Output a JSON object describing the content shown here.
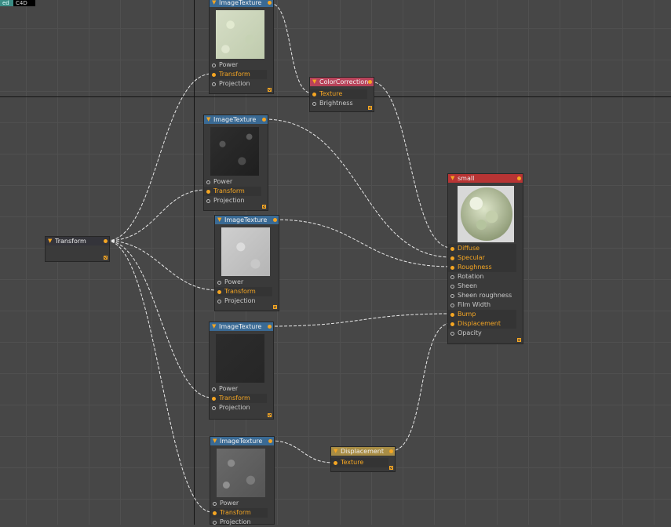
{
  "top_tags": {
    "left": "ed",
    "right": "C4D"
  },
  "colors": {
    "wire": "#e8e8e8",
    "port_accent": "#f5a623",
    "image_texture_header": "#3a6a94",
    "color_correction_header": "#b8435a",
    "material_header": "#b83434",
    "displacement_header": "#a88d45"
  },
  "nodes": {
    "transform": {
      "title": "Transform"
    },
    "tex1": {
      "title": "ImageTexture",
      "thumb": "light-green-marble-swatch",
      "ports": [
        "Power",
        "Transform",
        "Projection"
      ]
    },
    "tex2": {
      "title": "ImageTexture",
      "thumb": "dark-stone-swatch",
      "ports": [
        "Power",
        "Transform",
        "Projection"
      ]
    },
    "tex3": {
      "title": "ImageTexture",
      "thumb": "light-gray-stone-swatch",
      "ports": [
        "Power",
        "Transform",
        "Projection"
      ]
    },
    "tex4": {
      "title": "ImageTexture",
      "thumb": "dark-flat-swatch",
      "ports": [
        "Power",
        "Transform",
        "Projection"
      ]
    },
    "tex5": {
      "title": "ImageTexture",
      "thumb": "gray-speckled-swatch",
      "ports": [
        "Power",
        "Transform",
        "Projection"
      ]
    },
    "colorcorr": {
      "title": "ColorCorrection",
      "ports": [
        "Texture",
        "Brightness"
      ]
    },
    "material": {
      "title": "small",
      "preview": "marble-sphere-preview",
      "ports": [
        "Diffuse",
        "Specular",
        "Roughness",
        "Rotation",
        "Sheen",
        "Sheen roughness",
        "Film Width",
        "Bump",
        "Displacement",
        "Opacity"
      ]
    },
    "displacement": {
      "title": "Displacement",
      "ports": [
        "Texture"
      ]
    }
  }
}
